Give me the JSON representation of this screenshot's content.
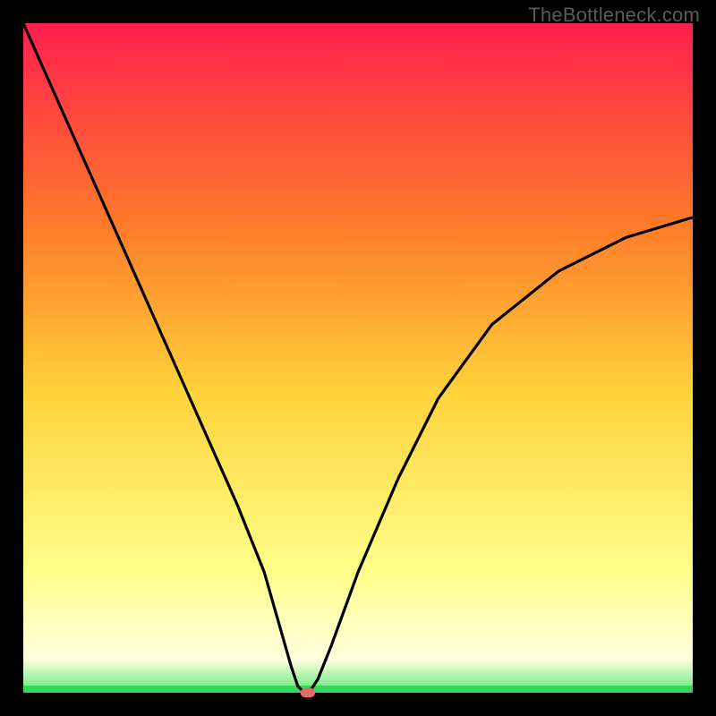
{
  "watermark": "TheBottleneck.com",
  "chart_data": {
    "type": "line",
    "title": "",
    "xlabel": "",
    "ylabel": "",
    "xlim": [
      0,
      100
    ],
    "ylim": [
      0,
      100
    ],
    "grid": false,
    "legend": false,
    "background_gradient": {
      "top": "#ff1f4f",
      "mid_upper": "#ff7a2a",
      "mid": "#ffd23a",
      "lower": "#ffff8a",
      "bottom_band": "#ffffe0",
      "bottom_thin": "#5ee87a"
    },
    "series": [
      {
        "name": "bottleneck-curve",
        "x": [
          0,
          4,
          8,
          12,
          16,
          20,
          24,
          28,
          32,
          36,
          38,
          40,
          41,
          42,
          43,
          44,
          46,
          50,
          56,
          62,
          70,
          80,
          90,
          100
        ],
        "y": [
          100,
          91,
          82,
          73,
          64,
          55,
          46,
          37,
          28,
          18,
          11,
          4,
          1,
          0,
          0.5,
          2,
          7,
          18,
          32,
          44,
          55,
          63,
          68,
          71
        ]
      }
    ],
    "marker": {
      "name": "result-marker",
      "x": 42.5,
      "y": 0,
      "color": "#e46a6a",
      "width": 2.2,
      "height": 1.4
    },
    "colors": {
      "curve": "#000000",
      "frame": "#000000"
    }
  }
}
